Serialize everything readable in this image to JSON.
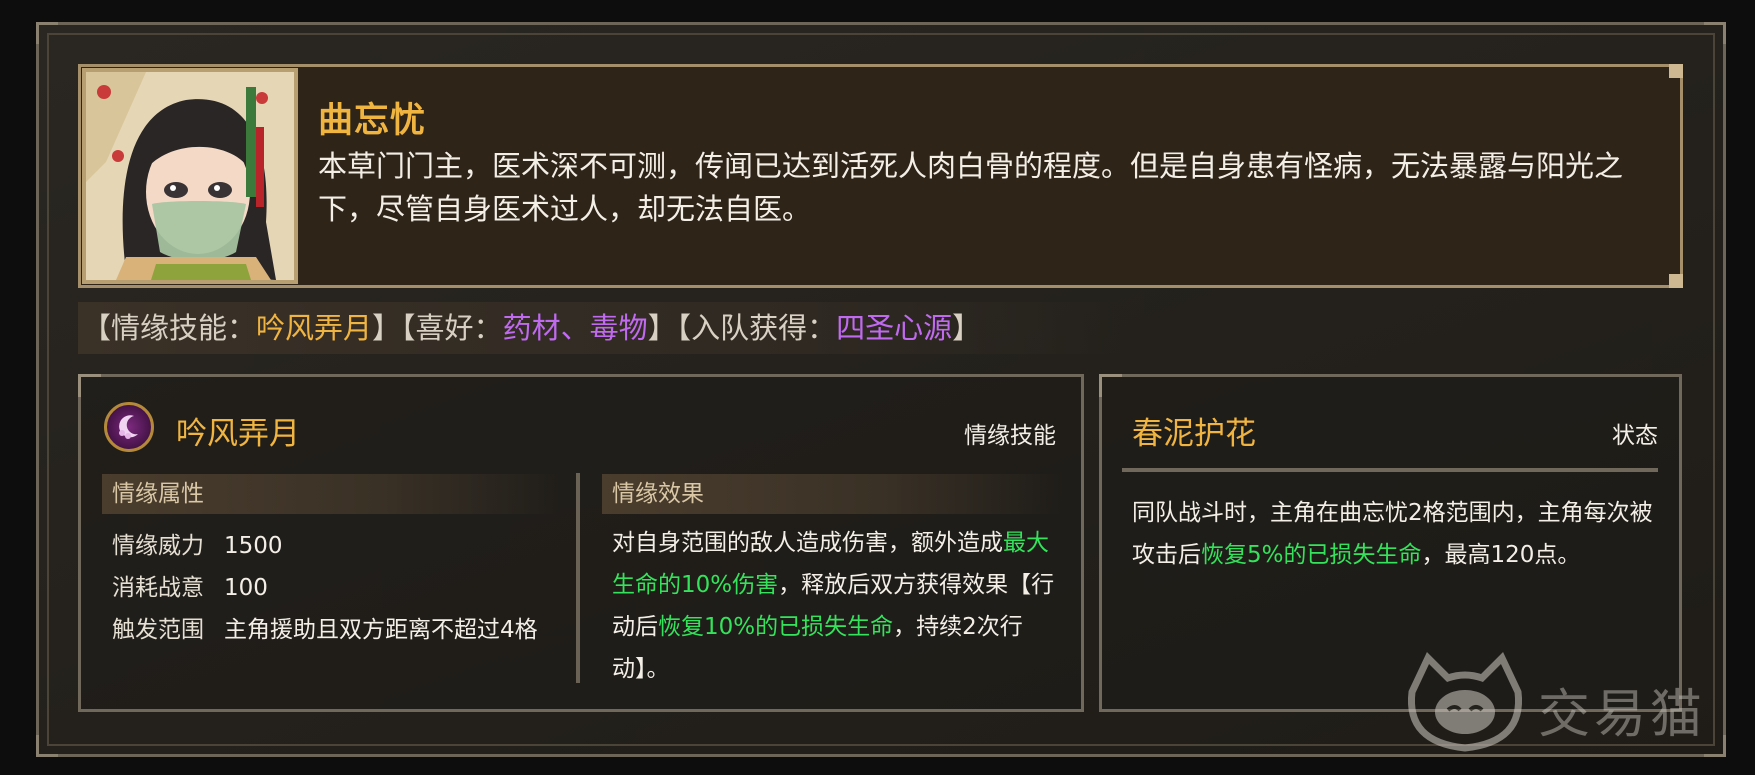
{
  "character": {
    "name": "曲忘忧",
    "description": "本草门门主，医术深不可测，传闻已达到活死人肉白骨的程度。但是自身患有怪病，无法暴露与阳光之下，尽管自身医术过人，却无法自医。"
  },
  "info_strip": {
    "skill_prefix": "【情缘技能：",
    "skill_value": "吟风弄月",
    "skill_suffix": "】",
    "likes_prefix": "【喜好：",
    "likes_value": "药材、毒物",
    "likes_suffix": "】",
    "join_prefix": "【入队获得：",
    "join_value": "四圣心源",
    "join_suffix": "】"
  },
  "skill": {
    "title": "吟风弄月",
    "type_label": "情缘技能",
    "attributes_header": "情缘属性",
    "effects_header": "情缘效果",
    "attributes": [
      {
        "label": "情缘威力",
        "value": "1500"
      },
      {
        "label": "消耗战意",
        "value": "100"
      },
      {
        "label": "触发范围",
        "value": "主角援助且双方距离不超过4格"
      }
    ],
    "effect": {
      "t1": "对自身范围的敌人造成伤害，额外造成",
      "g1": "最大生命的10%伤害",
      "t2": "，释放后双方获得效果【行动后",
      "g2": "恢复10%的已损失生命",
      "t3": "，持续2次行动】。"
    }
  },
  "state": {
    "title": "春泥护花",
    "type_label": "状态",
    "text": {
      "t1": "同队战斗时，主角在曲忘忧2格范围内，主角每次被攻击后",
      "g1": "恢复5%的已损失生命",
      "t2": "，最高120点。"
    }
  },
  "watermark": {
    "text": "交易猫"
  },
  "colors": {
    "gold": "#f0b441",
    "purple": "#c06af0",
    "green": "#34e35b"
  },
  "icons": {
    "skill": "moon-cloud-icon",
    "watermark": "cat-logo-icon"
  }
}
